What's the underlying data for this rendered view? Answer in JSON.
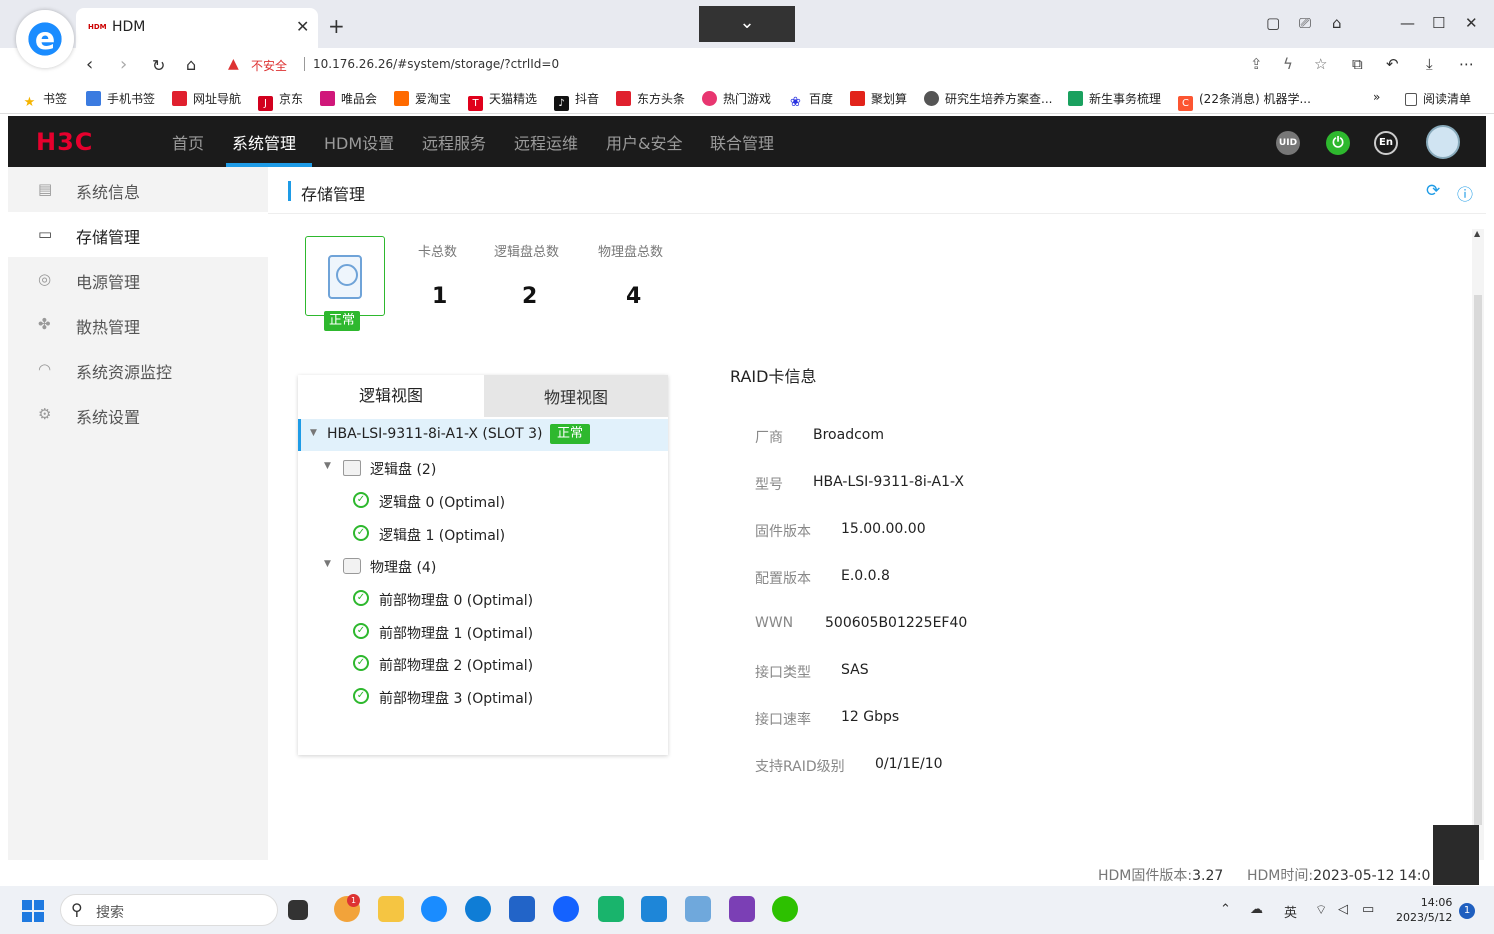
{
  "browser": {
    "tab_title": "HDM",
    "tab_favicon": "HDM",
    "insecure_label": "不安全",
    "url": "10.176.26.26/#system/storage/?ctrlId=0",
    "bookmarks": [
      {
        "label": "书签",
        "color": "#f5b400"
      },
      {
        "label": "手机书签",
        "color": "#3b7be0"
      },
      {
        "label": "网址导航",
        "color": "#e0202e"
      },
      {
        "label": "京东",
        "color": "#d2001e"
      },
      {
        "label": "唯品会",
        "color": "#d0177a"
      },
      {
        "label": "爱淘宝",
        "color": "#ff6a00"
      },
      {
        "label": "天猫精选",
        "color": "#e0001b"
      },
      {
        "label": "抖音",
        "color": "#111111"
      },
      {
        "label": "东方头条",
        "color": "#e0202e"
      },
      {
        "label": "热门游戏",
        "color": "#e83670"
      },
      {
        "label": "百度",
        "color": "#2932e1"
      },
      {
        "label": "聚划算",
        "color": "#e2231a"
      },
      {
        "label": "研究生培养方案查...",
        "color": "#555555"
      },
      {
        "label": "新生事务梳理",
        "color": "#1aa15f"
      },
      {
        "label": "(22条消息) 机器学...",
        "color": "#fc5531"
      }
    ],
    "bookmarks_more": "»",
    "reading_list": "阅读清单"
  },
  "app": {
    "logo": "H3C",
    "nav": [
      "首页",
      "系统管理",
      "HDM设置",
      "远程服务",
      "远程运维",
      "用户&安全",
      "联合管理"
    ],
    "active_nav": "系统管理",
    "uid_label": "UID",
    "lang_label": "En",
    "sidebar": [
      {
        "label": "系统信息",
        "icon": "list-icon"
      },
      {
        "label": "存储管理",
        "icon": "storage-icon"
      },
      {
        "label": "电源管理",
        "icon": "power-icon"
      },
      {
        "label": "散热管理",
        "icon": "fan-icon"
      },
      {
        "label": "系统资源监控",
        "icon": "gauge-icon"
      },
      {
        "label": "系统设置",
        "icon": "gear-icon"
      }
    ],
    "page_title": "存储管理",
    "summary": {
      "status": "正常",
      "stats": [
        {
          "label": "卡总数",
          "value": "1"
        },
        {
          "label": "逻辑盘总数",
          "value": "2"
        },
        {
          "label": "物理盘总数",
          "value": "4"
        }
      ]
    },
    "tree": {
      "tab_logical": "逻辑视图",
      "tab_physical": "物理视图",
      "card": "HBA-LSI-9311-8i-A1-X (SLOT 3)",
      "card_status": "正常",
      "logical_group": "逻辑盘 (2)",
      "logical": [
        "逻辑盘 0 (Optimal)",
        "逻辑盘 1 (Optimal)"
      ],
      "physical_group": "物理盘 (4)",
      "physical": [
        "前部物理盘 0 (Optimal)",
        "前部物理盘 1 (Optimal)",
        "前部物理盘 2 (Optimal)",
        "前部物理盘 3 (Optimal)"
      ]
    },
    "raid": {
      "title": "RAID卡信息",
      "fields": [
        {
          "label": "厂商",
          "value": "Broadcom"
        },
        {
          "label": "型号",
          "value": "HBA-LSI-9311-8i-A1-X"
        },
        {
          "label": "固件版本",
          "value": "15.00.00.00"
        },
        {
          "label": "配置版本",
          "value": "E.0.0.8"
        },
        {
          "label": "WWN",
          "value": "500605B01225EF40"
        },
        {
          "label": "接口类型",
          "value": "SAS"
        },
        {
          "label": "接口速率",
          "value": "12 Gbps"
        },
        {
          "label": "支持RAID级别",
          "value": "0/1/1E/10"
        }
      ]
    },
    "footer": {
      "fw_label": "HDM固件版本:",
      "fw_value": "3.27",
      "time_label": "HDM时间:",
      "time_value": "2023-05-12 14:0"
    }
  },
  "taskbar": {
    "search_placeholder": "搜索",
    "notif_badge": "1",
    "ime": "英",
    "time": "14:06",
    "date": "2023/5/12",
    "notification_count": "1"
  }
}
